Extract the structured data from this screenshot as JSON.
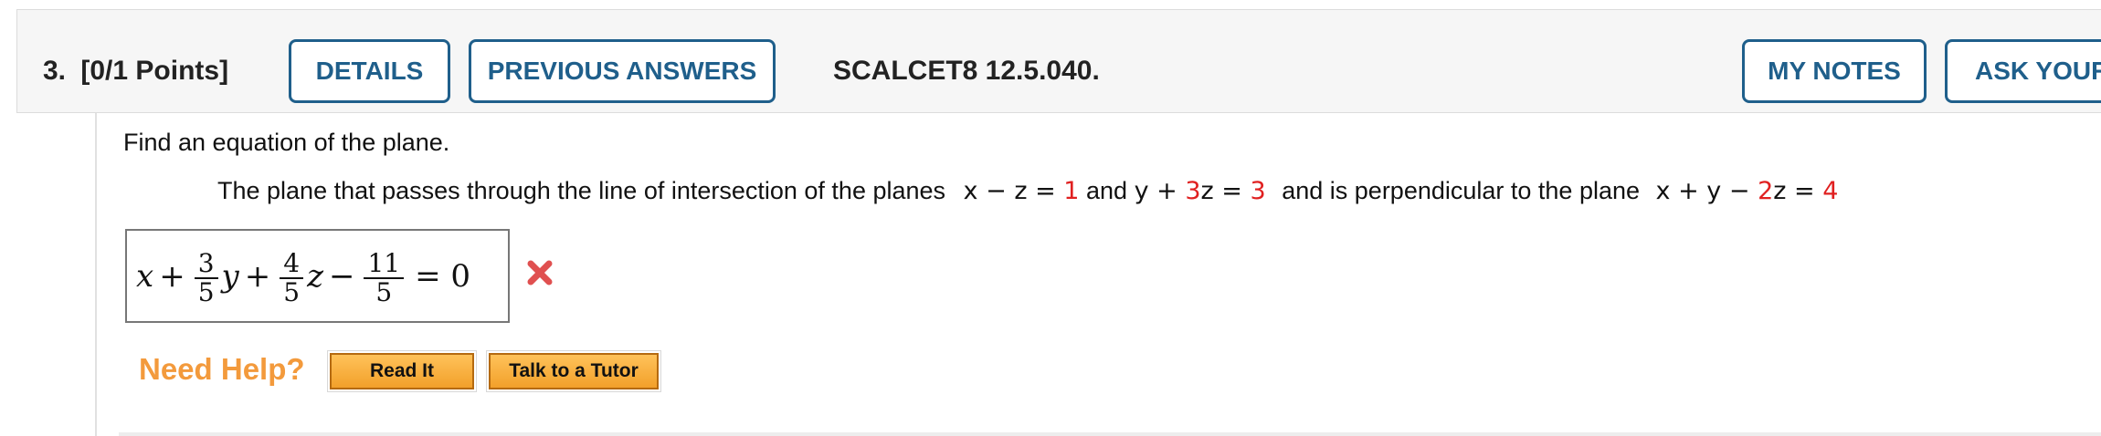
{
  "question": {
    "number_label": "3.",
    "points_label": "[0/1 Points]",
    "code": "SCALCET8 12.5.040."
  },
  "toolbar": {
    "details_label": "DETAILS",
    "previous_answers_label": "PREVIOUS ANSWERS",
    "my_notes_label": "MY NOTES",
    "ask_label": "ASK YOUR"
  },
  "content": {
    "instruction": "Find an equation of the plane.",
    "problem_prefix": "The plane that passes through the line of intersection of the planes",
    "plane1": {
      "lhs": "x − z =",
      "rhs": "1"
    },
    "and_label": "and",
    "plane2": {
      "a": "y +",
      "coef": "3",
      "b": "z =",
      "rhs": "3"
    },
    "perp_label": "and is perpendicular to the plane",
    "plane3": {
      "a": "x + y −",
      "coef": "2",
      "b": "z =",
      "rhs": "4"
    }
  },
  "answer": {
    "x": "x",
    "plus1": "+",
    "f1_num": "3",
    "f1_den": "5",
    "y": "y",
    "plus2": "+",
    "f2_num": "4",
    "f2_den": "5",
    "z": "z",
    "minus": "−",
    "f3_num": "11",
    "f3_den": "5",
    "equals": "= 0",
    "status": "incorrect"
  },
  "help": {
    "need_help": "Need Help?",
    "read_it": "Read It",
    "talk_to_tutor": "Talk to a Tutor"
  },
  "colors": {
    "accent": "#1f5f8b",
    "error": "#e02020",
    "help_orange": "#f39a3c"
  }
}
